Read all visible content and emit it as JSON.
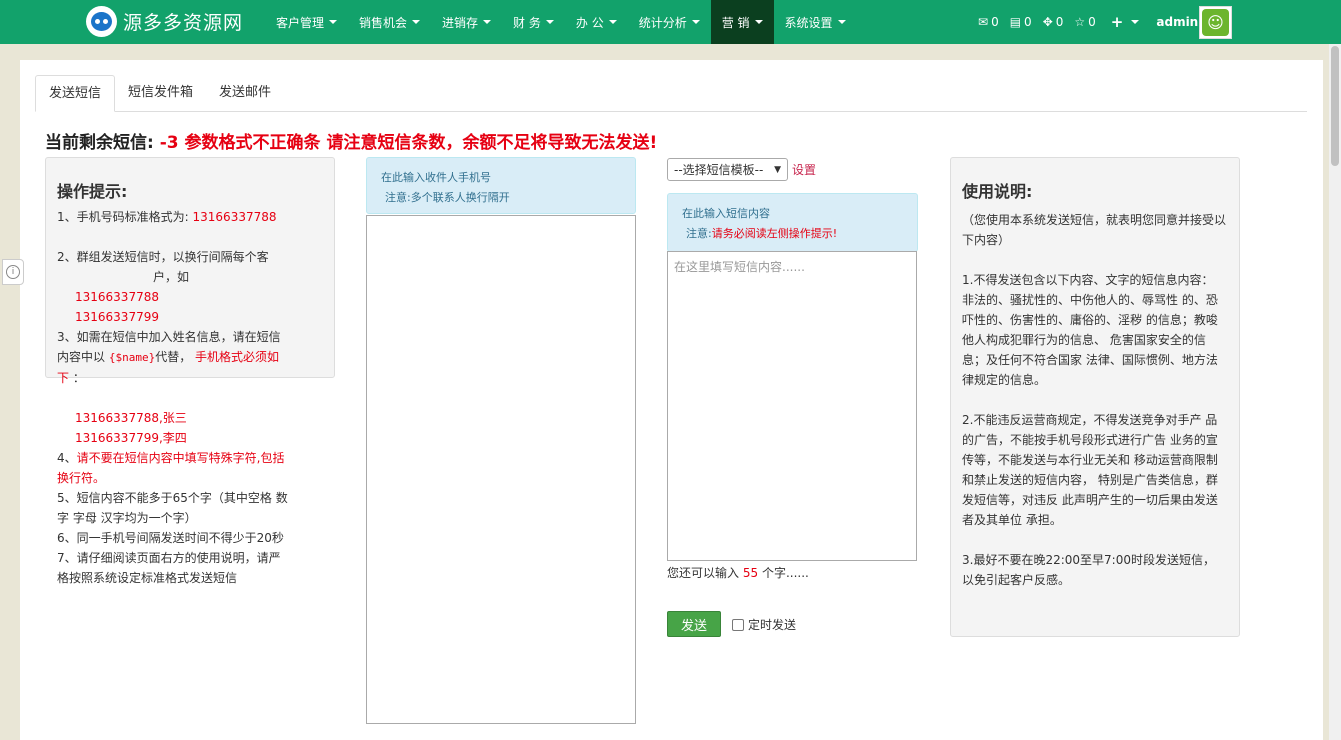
{
  "brand": {
    "name": "源多多资源网"
  },
  "nav": {
    "menu": [
      {
        "label": "客户管理",
        "active": false
      },
      {
        "label": "销售机会",
        "active": false
      },
      {
        "label": "进销存",
        "active": false
      },
      {
        "label": "财 务",
        "active": false
      },
      {
        "label": "办 公",
        "active": false
      },
      {
        "label": "统计分析",
        "active": false
      },
      {
        "label": "营 销",
        "active": true
      },
      {
        "label": "系统设置",
        "active": false
      }
    ],
    "stats": [
      {
        "icon": "envelope-icon",
        "glyph": "✉",
        "count": "0"
      },
      {
        "icon": "inbox-icon",
        "glyph": "▤",
        "count": "0"
      },
      {
        "icon": "move-icon",
        "glyph": "✥",
        "count": "0"
      },
      {
        "icon": "star-icon",
        "glyph": "☆",
        "count": "0"
      }
    ],
    "plus_glyph": "+",
    "user": "admin"
  },
  "tabs": [
    "发送短信",
    "短信发件箱",
    "发送邮件"
  ],
  "headline": {
    "label": "当前剩余短信:",
    "warning": "-3 参数格式不正确条 请注意短信条数，余额不足将导致无法发送!"
  },
  "tips": {
    "title": "操作提示:",
    "l1_a": "1、手机号码标准格式为:",
    "l1_b": "13166337788",
    "l2_a": "2、群组发送短信时，以换行间隔每个客",
    "l2_b": "户，如",
    "l2_c": "13166337788",
    "l2_d": "13166337799",
    "l3_a": "3、如需在短信中加入姓名信息，请在短信",
    "l3_b": "内容中以",
    "l3_code": "{$name}",
    "l3_c": "代替，",
    "l3_d": "手机格式必须如",
    "l3_e": "下",
    "l3_f": "：",
    "l3_g": "13166337788,张三",
    "l3_h": "13166337799,李四",
    "l4_a": "4、",
    "l4_b": "请不要在短信内容中填写特殊字符,包括",
    "l4_c": "换行符。",
    "l5_a": "5、短信内容不能多于65个字（其中空格 数",
    "l5_b": "字 字母 汉字均为一个字）",
    "l6": "6、同一手机号间隔发送时间不得少于20秒",
    "l7_a": "7、请仔细阅读页面右方的使用说明，请严",
    "l7_b": "格按照系统设定标准格式发送短信"
  },
  "recipients": {
    "info": "在此输入收件人手机号",
    "note": "注意:多个联系人换行隔开"
  },
  "sms": {
    "template_select": "--选择短信模板--",
    "template_link": "设置",
    "info": "在此输入短信内容",
    "note_prefix": "注意:",
    "note_red": "请务必阅读左侧操作提示!",
    "placeholder": "在这里填写短信内容......",
    "counter_prefix": "您还可以输入",
    "counter_value": "55",
    "counter_suffix": "个字......",
    "send_label": "发送",
    "timed_label": "定时发送"
  },
  "usage": {
    "title": "使用说明:",
    "text": "（您使用本系统发送短信，就表明您同意并接受以下内容）\n\n1.不得发送包含以下内容、文字的短信息内容： 非法的、骚扰性的、中伤他人的、辱骂性 的、恐吓性的、伤害性的、庸俗的、淫秽 的信息；教唆他人构成犯罪行为的信息、 危害国家安全的信息；及任何不符合国家 法律、国际惯例、地方法律规定的信息。\n\n2.不能违反运营商规定，不得发送竞争对手产 品的广告，不能按手机号段形式进行广告 业务的宣传等，不能发送与本行业无关和 移动运营商限制和禁止发送的短信内容， 特别是广告类信息，群发短信等，对违反 此声明产生的一切后果由发送者及其单位 承担。\n\n3.最好不要在晚22:00至早7:00时段发送短信， 以免引起客户反感。"
  },
  "colors": {
    "navbar": "#12a26b",
    "nav_active": "#0b3f1f",
    "warning": "#e60012",
    "send_button": "#47a447",
    "info_bg": "#d9edf7"
  }
}
